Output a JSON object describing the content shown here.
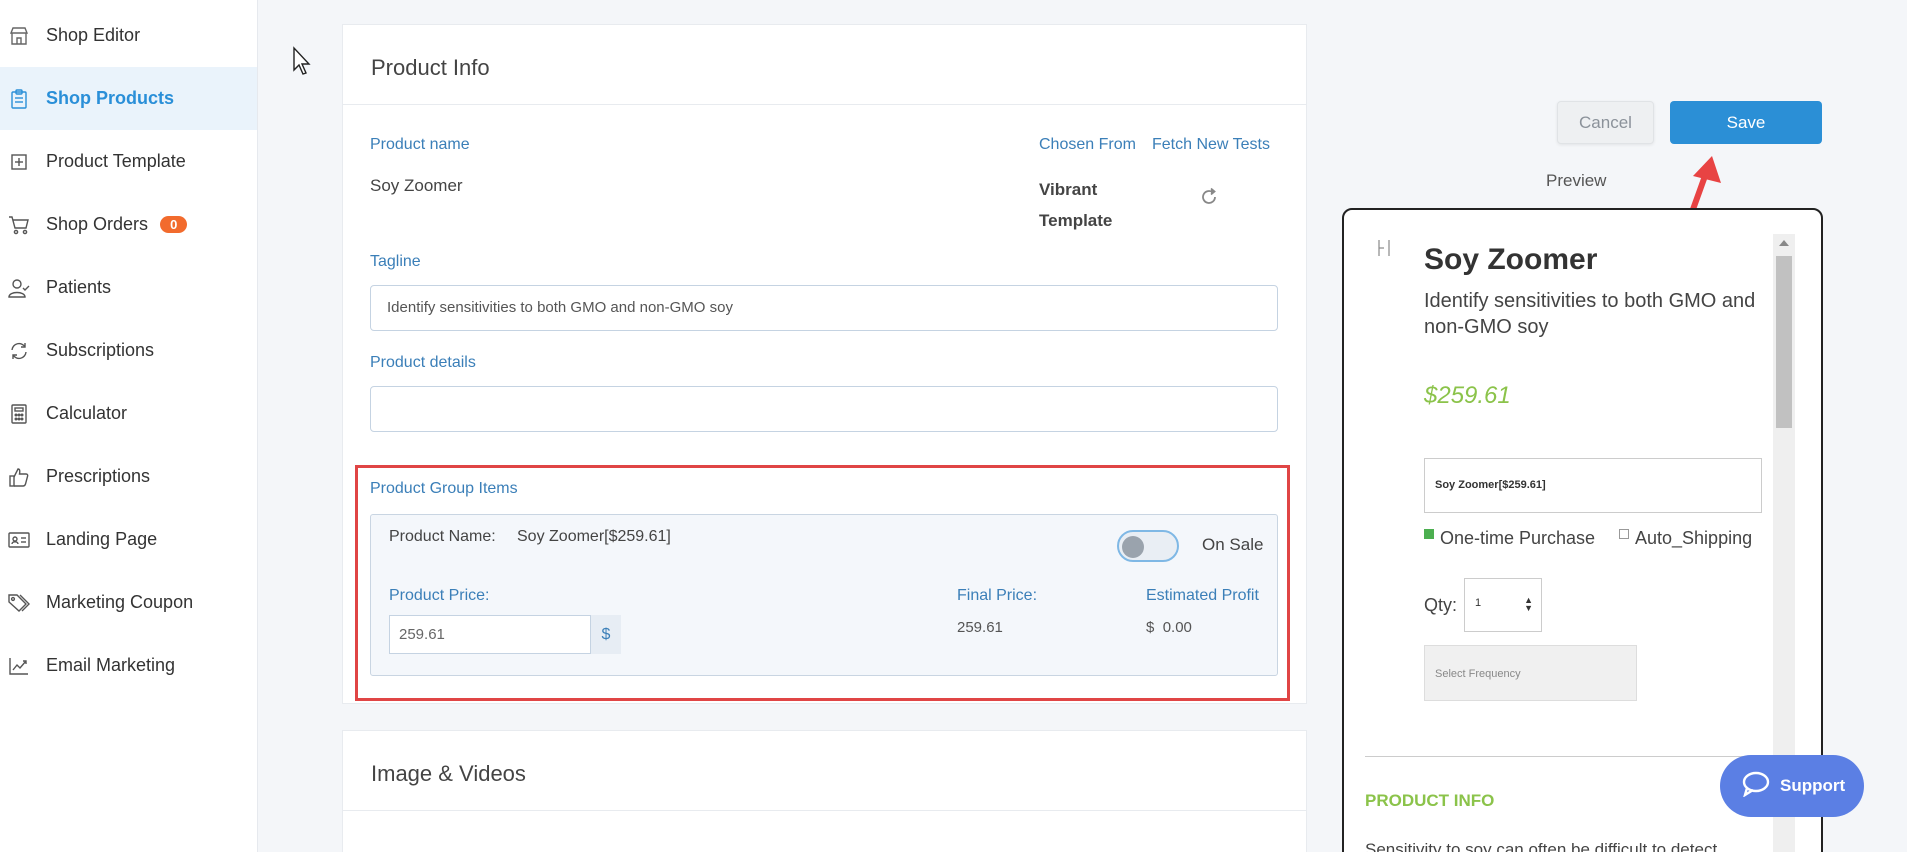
{
  "sidebar": {
    "items": [
      {
        "label": "Shop Editor",
        "icon": "store-icon"
      },
      {
        "label": "Shop Products",
        "icon": "clipboard-icon",
        "active": true
      },
      {
        "label": "Product Template",
        "icon": "plus-square-icon"
      },
      {
        "label": "Shop Orders",
        "icon": "cart-icon",
        "badge": "0"
      },
      {
        "label": "Patients",
        "icon": "user-icon"
      },
      {
        "label": "Subscriptions",
        "icon": "refresh-icon"
      },
      {
        "label": "Calculator",
        "icon": "calculator-icon"
      },
      {
        "label": "Prescriptions",
        "icon": "thumbs-up-icon"
      },
      {
        "label": "Landing Page",
        "icon": "id-card-icon"
      },
      {
        "label": "Marketing Coupon",
        "icon": "tags-icon"
      },
      {
        "label": "Email Marketing",
        "icon": "chart-line-icon"
      }
    ]
  },
  "product_info": {
    "title": "Product Info",
    "product_name_label": "Product name",
    "product_name": "Soy Zoomer",
    "chosen_from_label": "Chosen From",
    "fetch_new_tests_label": "Fetch New Tests",
    "template_line1": "Vibrant",
    "template_line2": "Template",
    "tagline_label": "Tagline",
    "tagline_value": "Identify sensitivities to both GMO and non-GMO soy",
    "details_label": "Product details",
    "details_value": "",
    "group_items_label": "Product Group Items",
    "group": {
      "name_label": "Product Name:",
      "name_value": "Soy Zoomer[$259.61]",
      "on_sale_label": "On Sale",
      "on_sale": false,
      "price_label": "Product Price:",
      "price_value": "259.61",
      "currency_symbol": "$",
      "final_price_label": "Final Price:",
      "final_price_value": "259.61",
      "profit_label": "Estimated Profit",
      "profit_currency": "$",
      "profit_value": "0.00"
    }
  },
  "images_section": {
    "title": "Image & Videos"
  },
  "actions": {
    "cancel_label": "Cancel",
    "save_label": "Save"
  },
  "preview": {
    "label": "Preview",
    "product_title": "Soy Zoomer",
    "tagline": "Identify sensitivities to both GMO and non-GMO soy",
    "price": "$259.61",
    "variant_select": "Soy Zoomer[$259.61]",
    "one_time_label": "One-time Purchase",
    "auto_shipping_label": "Auto_Shipping",
    "qty_label": "Qty:",
    "qty_value": "1",
    "frequency_placeholder": "Select Frequency",
    "product_info_heading": "PRODUCT INFO",
    "description_partial": "Sensitivity to soy can often be difficult to detect"
  },
  "support": {
    "label": "Support"
  },
  "colors": {
    "accent": "#2b8fd6",
    "label_blue": "#3b7fb8",
    "price_green": "#8bc34a",
    "highlight_red": "#e04545",
    "badge_orange": "#f26b2d"
  }
}
